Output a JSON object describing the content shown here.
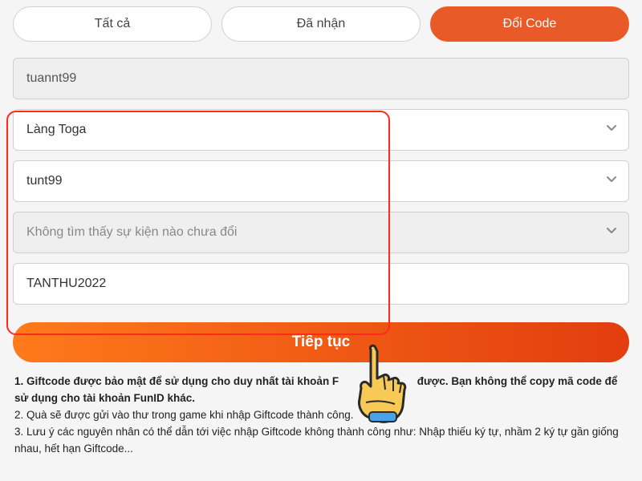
{
  "tabs": {
    "all": "Tất cả",
    "received": "Đã nhận",
    "redeem": "Đổi Code"
  },
  "fields": {
    "username": "tuannt99",
    "server": "Làng Toga",
    "character": "tunt99",
    "event": "Không tìm thấy sự kiện nào chưa đổi",
    "code": "TANTHU2022"
  },
  "submit_label": "Tiếp tục",
  "notes": {
    "line1a": "1. Giftcode được bảo mật để sử dụng cho duy nhất tài khoản F",
    "line1b": "được. Bạn không thể copy mã code để sử dụng cho tài khoản FunID khác.",
    "line2": "2. Quà sẽ được gửi vào thư trong game khi nhập Giftcode thành công.",
    "line3": "3. Lưu ý các nguyên nhân có thể dẫn tới việc nhập Giftcode không thành công như: Nhập thiếu ký tự, nhầm 2 ký tự gần giống nhau, hết hạn Giftcode..."
  }
}
